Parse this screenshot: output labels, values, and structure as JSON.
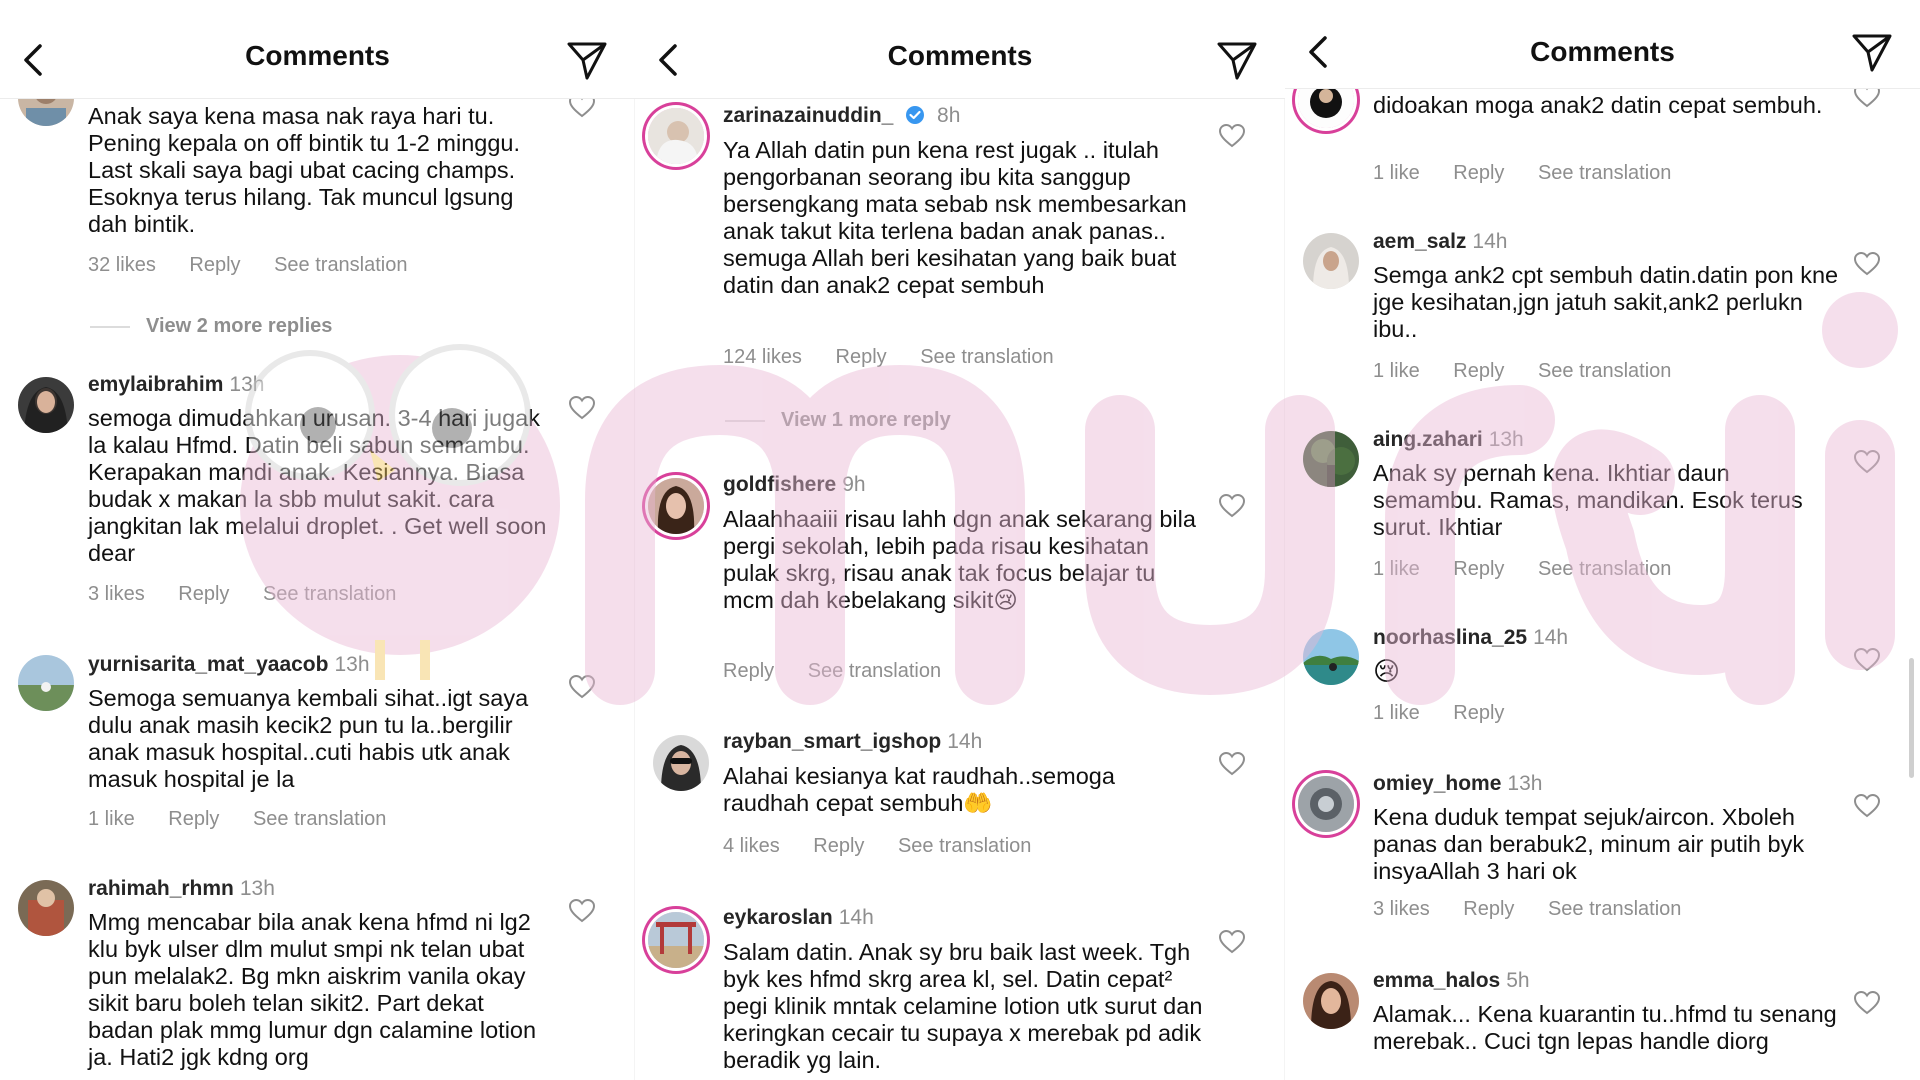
{
  "panels": [
    {
      "title": "Comments",
      "comments": [
        {
          "user": "",
          "time": "",
          "text": "Anak saya kena masa nak raya hari tu. Pening kepala on off bintik tu 1-2 minggu. Last skali saya bagi ubat cacing champs. Esoknya terus hilang. Tak muncul lgsung dah bintik.",
          "likes": "32 likes",
          "reply": "Reply",
          "translate": "See translation"
        },
        {
          "user": "emylaibrahim",
          "time": "13h",
          "text": "semoga dimudahkan urusan. 3-4 hari jugak la kalau Hfmd. Datin beli sabun semambu. Kerapakan mandi anak. Kesiannya. Biasa budak x makan la sbb mulut sakit. cara jangkitan lak melalui droplet. . Get well soon dear",
          "likes": "3 likes",
          "reply": "Reply",
          "translate": "See translation"
        },
        {
          "user": "yurnisarita_mat_yaacob",
          "time": "13h",
          "text": "Semoga semuanya kembali sihat..igt saya dulu anak masih kecik2 pun tu la..bergilir anak masuk hospital..cuti habis utk anak masuk hospital je la",
          "likes": "1 like",
          "reply": "Reply",
          "translate": "See translation"
        },
        {
          "user": "rahimah_rhmn",
          "time": "13h",
          "text": "Mmg mencabar bila anak kena hfmd ni lg2 klu byk ulser dlm mulut smpi nk telan ubat pun melalak2. Bg mkn aiskrim vanila okay sikit baru boleh telan sikit2. Part dekat badan plak mmg lumur dgn calamine lotion ja. Hati2 jgk kdng org",
          "likes": "",
          "reply": "",
          "translate": ""
        }
      ],
      "more_replies": "View 2 more replies"
    },
    {
      "title": "Comments",
      "comments": [
        {
          "user": "zarinazainuddin_",
          "time": "8h",
          "text": "Ya Allah datin pun kena rest jugak .. itulah pengorbanan seorang ibu kita sanggup bersengkang mata sebab nsk membesarkan anak takut kita terlena badan anak panas.. semuga Allah beri kesihatan yang baik buat datin dan anak2 cepat sembuh",
          "likes": "124 likes",
          "reply": "Reply",
          "translate": "See translation"
        },
        {
          "user": "goldfishere",
          "time": "9h",
          "text": "Alaahhaaiii risau lahh dgn anak sekarang bila pergi sekolah, lebih pada risau kesihatan pulak skrg, risau anak tak focus belajar tu mcm dah kebelakang sikit😢",
          "likes": "",
          "reply": "Reply",
          "translate": "See translation"
        },
        {
          "user": "rayban_smart_igshop",
          "time": "14h",
          "text": "Alahai kesianya kat raudhah..semoga raudhah cepat sembuh🤲",
          "likes": "4 likes",
          "reply": "Reply",
          "translate": "See translation"
        },
        {
          "user": "eykaroslan",
          "time": "14h",
          "text": "Salam datin. Anak sy bru baik last week. Tgh byk kes hfmd skrg area kl, sel. Datin cepat² pegi klinik mntak celamine lotion utk surut dan keringkan cecair tu supaya x merebak pd adik beradik yg lain.",
          "likes": "",
          "reply": "",
          "translate": ""
        }
      ],
      "more_replies": "View 1 more reply"
    },
    {
      "title": "Comments",
      "comments": [
        {
          "user": "",
          "time": "",
          "text": "didoakan moga anak2 datin cepat sembuh.",
          "likes": "1 like",
          "reply": "Reply",
          "translate": "See translation"
        },
        {
          "user": "aem_salz",
          "time": "14h",
          "text": "Semga ank2 cpt sembuh datin.datin pon kne jge kesihatan,jgn jatuh sakit,ank2 perlukn ibu..",
          "likes": "1 like",
          "reply": "Reply",
          "translate": "See translation"
        },
        {
          "user": "aing.zahari",
          "time": "13h",
          "text": "Anak sy pernah kena. Ikhtiar daun semambu. Ramas, mandikan. Esok terus surut. Ikhtiar",
          "likes": "1 like",
          "reply": "Reply",
          "translate": "See translation"
        },
        {
          "user": "noorhaslina_25",
          "time": "14h",
          "text": "😢",
          "likes": "1 like",
          "reply": "Reply",
          "translate": ""
        },
        {
          "user": "omiey_home",
          "time": "13h",
          "text": "Kena duduk tempat sejuk/aircon. Xboleh panas dan berabuk2, minum air putih byk insyaAllah 3 hari ok",
          "likes": "3 likes",
          "reply": "Reply",
          "translate": "See translation"
        },
        {
          "user": "emma_halos",
          "time": "5h",
          "text": "Alamak... Kena kuarantin tu..hfmd tu senang merebak.. Cuci tgn lepas handle diorg",
          "likes": "",
          "reply": "",
          "translate": ""
        }
      ]
    }
  ],
  "icons": {
    "back": "chevron-left-icon",
    "send": "paper-plane-icon",
    "like": "heart-outline-icon",
    "verified": "verified-badge-icon"
  },
  "colors": {
    "ring": "#d8409a",
    "muted": "#8e8e8e",
    "verified": "#3897f0",
    "watermark": "#e9b8d4"
  }
}
